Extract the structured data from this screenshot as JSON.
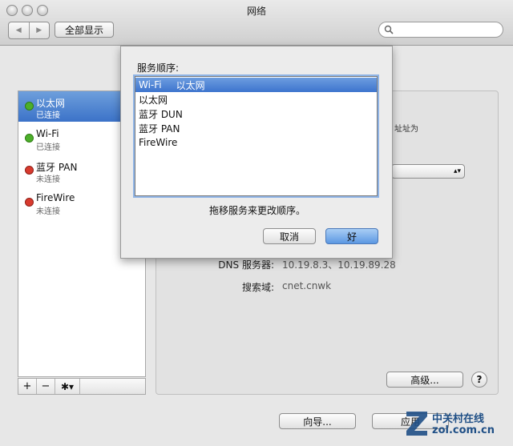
{
  "window": {
    "title": "网络"
  },
  "toolbar": {
    "back_glyph": "◀",
    "forward_glyph": "▶",
    "show_all_label": "全部显示"
  },
  "colors": {
    "green": "#4caf2a",
    "red": "#d83a2e",
    "selection": "#3d74ce"
  },
  "services": [
    {
      "name": "以太网",
      "status": "已连接",
      "state": "connected",
      "selected": true
    },
    {
      "name": "Wi-Fi",
      "status": "已连接",
      "state": "connected",
      "selected": false
    },
    {
      "name": "蓝牙 PAN",
      "status": "未连接",
      "state": "disconnected",
      "selected": false
    },
    {
      "name": "FireWire",
      "status": "未连接",
      "state": "disconnected",
      "selected": false
    }
  ],
  "sidebar_buttons": {
    "add": "+",
    "remove": "−",
    "gear": "✱▾"
  },
  "details": {
    "partial_text": "址址为",
    "dns_label": "DNS 服务器:",
    "dns_value": "10.19.8.3、10.19.89.28",
    "search_label": "搜索域:",
    "search_value": "cnet.cnwk",
    "advanced_label": "高级...",
    "help_label": "?"
  },
  "footer": {
    "assist_label": "向导...",
    "apply_label": "应用"
  },
  "sheet": {
    "title": "服务顺序:",
    "services": [
      "Wi-Fi",
      "以太网",
      "蓝牙 DUN",
      "蓝牙 PAN",
      "FireWire"
    ],
    "drag_item_label": "以太网",
    "hint": "拖移服务来更改顺序。",
    "cancel_label": "取消",
    "ok_label": "好"
  },
  "watermark": {
    "brand": "中关村在线",
    "domain": "zol.com.cn"
  }
}
